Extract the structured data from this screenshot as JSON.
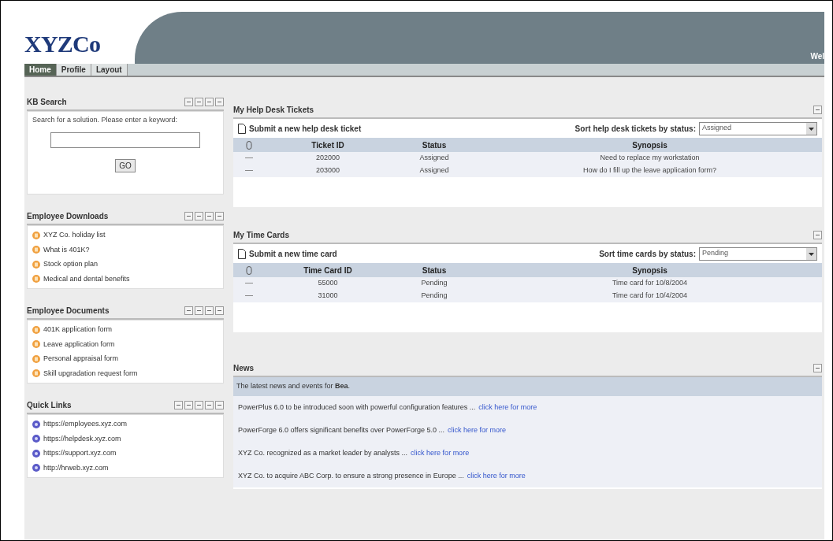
{
  "header": {
    "logo": "XYZCo",
    "welcome": "Wel"
  },
  "tabs": [
    {
      "label": "Home",
      "selected": true
    },
    {
      "label": "Profile",
      "selected": false
    },
    {
      "label": "Layout",
      "selected": false
    }
  ],
  "kb_search": {
    "title": "KB Search",
    "prompt": "Search for a solution. Please enter a keyword:",
    "button": "GO"
  },
  "side_portlets": [
    {
      "title": "Employee Downloads",
      "kind": "document",
      "items": [
        "XYZ Co. holiday list",
        "What is 401K?",
        "Stock option plan",
        "Medical and dental benefits"
      ]
    },
    {
      "title": "Employee Documents",
      "kind": "document",
      "items": [
        "401K application form",
        "Leave application form",
        "Personal appraisal form",
        "Skill upgradation request form"
      ]
    },
    {
      "title": "Quick Links",
      "kind": "link",
      "items": [
        "https://employees.xyz.com",
        "https://helpdesk.xyz.com",
        "https://support.xyz.com",
        "http://hrweb.xyz.com"
      ]
    }
  ],
  "tables": [
    {
      "title": "My Help Desk Tickets",
      "submit": "Submit a new help desk ticket",
      "sort_label": "Sort help desk tickets by status:",
      "sort_value": "Assigned",
      "columns": [
        "Ticket ID",
        "Status",
        "Synopsis"
      ],
      "rows": [
        [
          "202000",
          "Assigned",
          "Need to replace my workstation"
        ],
        [
          "203000",
          "Assigned",
          "How do I fill up the leave application form?"
        ]
      ]
    },
    {
      "title": "My Time Cards",
      "submit": "Submit a new time card",
      "sort_label": "Sort time cards by status:",
      "sort_value": "Pending",
      "columns": [
        "Time Card ID",
        "Status",
        "Synopsis"
      ],
      "rows": [
        [
          "55000",
          "Pending",
          "Time card for 10/8/2004"
        ],
        [
          "31000",
          "Pending",
          "Time card for 10/4/2004"
        ]
      ]
    }
  ],
  "news": {
    "title": "News",
    "intro": "The latest news and events for **Bea**.",
    "items": [
      {
        "text": "PowerPlus 6.0 to be introduced soon with powerful configuration features ...",
        "link": "click here for more"
      },
      {
        "text": "PowerForge 6.0 offers significant benefits over PowerForge 5.0 ...",
        "link": "click here for more"
      },
      {
        "text": "XYZ Co. recognized as a market leader by analysts ...",
        "link": "click here for more"
      },
      {
        "text": "XYZ Co. to acquire ABC Corp. to ensure a strong presence in Europe ...",
        "link": "click here for more"
      }
    ]
  }
}
